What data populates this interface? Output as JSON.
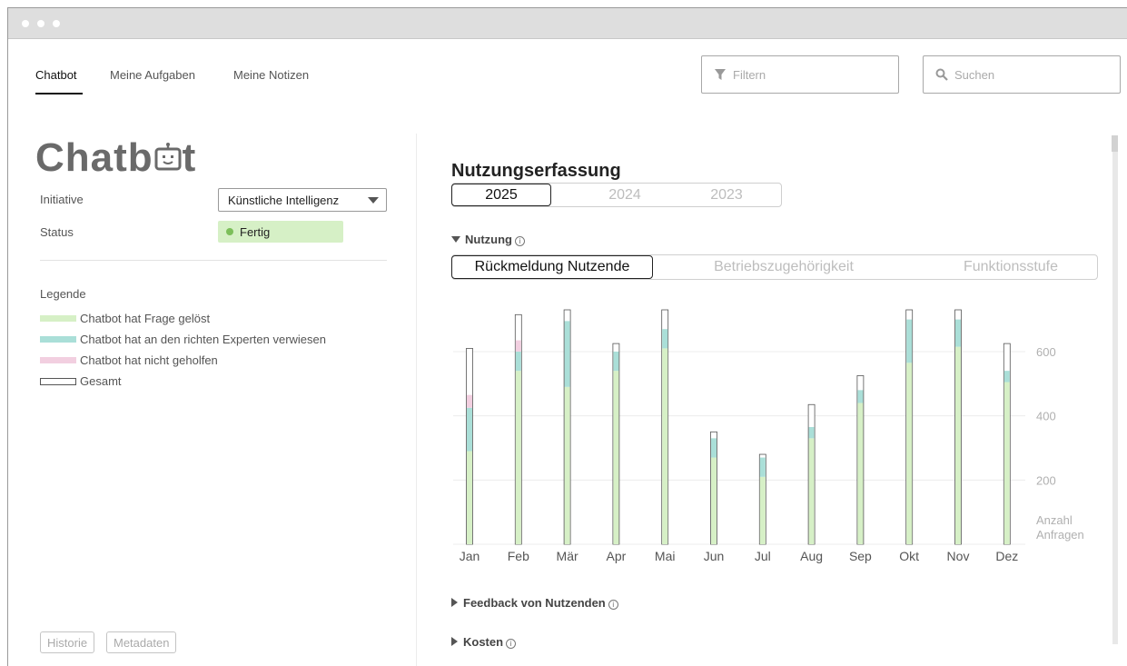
{
  "nav": {
    "tabs": [
      "Chatbot",
      "Meine Aufgaben",
      "Meine Notizen"
    ],
    "active_tab": "Chatbot",
    "filter_placeholder": "Filtern",
    "search_placeholder": "Suchen"
  },
  "detail": {
    "title_prefix": "Chatb",
    "title_suffix": "t",
    "initiative_label": "Initiative",
    "initiative_value": "Künstliche Intelligenz",
    "status_label": "Status",
    "status_value": "Fertig",
    "legend_title": "Legende",
    "legend": [
      {
        "label": "Chatbot hat Frage gelöst",
        "color": "#d6f0c6"
      },
      {
        "label": "Chatbot hat an den richten Experten verwiesen",
        "color": "#aadfd8"
      },
      {
        "label": "Chatbot hat nicht geholfen",
        "color": "#f2cfe0"
      },
      {
        "label": "Gesamt",
        "color": "#ffffff"
      }
    ],
    "buttons": [
      "Historie",
      "Metadaten"
    ]
  },
  "usage": {
    "title": "Nutzungserfassung",
    "years": [
      "2025",
      "2024",
      "2023"
    ],
    "active_year": "2025",
    "section_open": "Nutzung",
    "views": [
      "Rückmeldung Nutzende",
      "Betriebszugehörigkeit",
      "Funktionsstufe"
    ],
    "active_view": "Rückmeldung Nutzende",
    "collapsed_sections": [
      "Feedback von Nutzenden",
      "Kosten"
    ]
  },
  "chart_data": {
    "type": "bar",
    "categories": [
      "Jan",
      "Feb",
      "Mär",
      "Apr",
      "Mai",
      "Jun",
      "Jul",
      "Aug",
      "Sep",
      "Okt",
      "Nov",
      "Dez"
    ],
    "series": [
      {
        "name": "Chatbot hat Frage gelöst",
        "values": [
          290,
          540,
          490,
          540,
          610,
          270,
          210,
          330,
          440,
          565,
          615,
          505
        ],
        "color": "#d6f0c6"
      },
      {
        "name": "Chatbot hat an den richten Experten verwiesen",
        "values": [
          135,
          60,
          205,
          60,
          60,
          60,
          60,
          35,
          40,
          135,
          85,
          35
        ],
        "color": "#aadfd8"
      },
      {
        "name": "Chatbot hat nicht geholfen",
        "values": [
          40,
          35,
          0,
          0,
          0,
          0,
          0,
          0,
          0,
          0,
          0,
          0
        ],
        "color": "#f2cfe0"
      },
      {
        "name": "Gesamt",
        "values": [
          610,
          715,
          730,
          625,
          730,
          350,
          280,
          435,
          525,
          730,
          730,
          625
        ],
        "color": "#ffffff"
      }
    ],
    "yticks": [
      200,
      400,
      600
    ],
    "ylabel": "Anzahl Anfragen",
    "ylim": [
      0,
      730
    ]
  }
}
